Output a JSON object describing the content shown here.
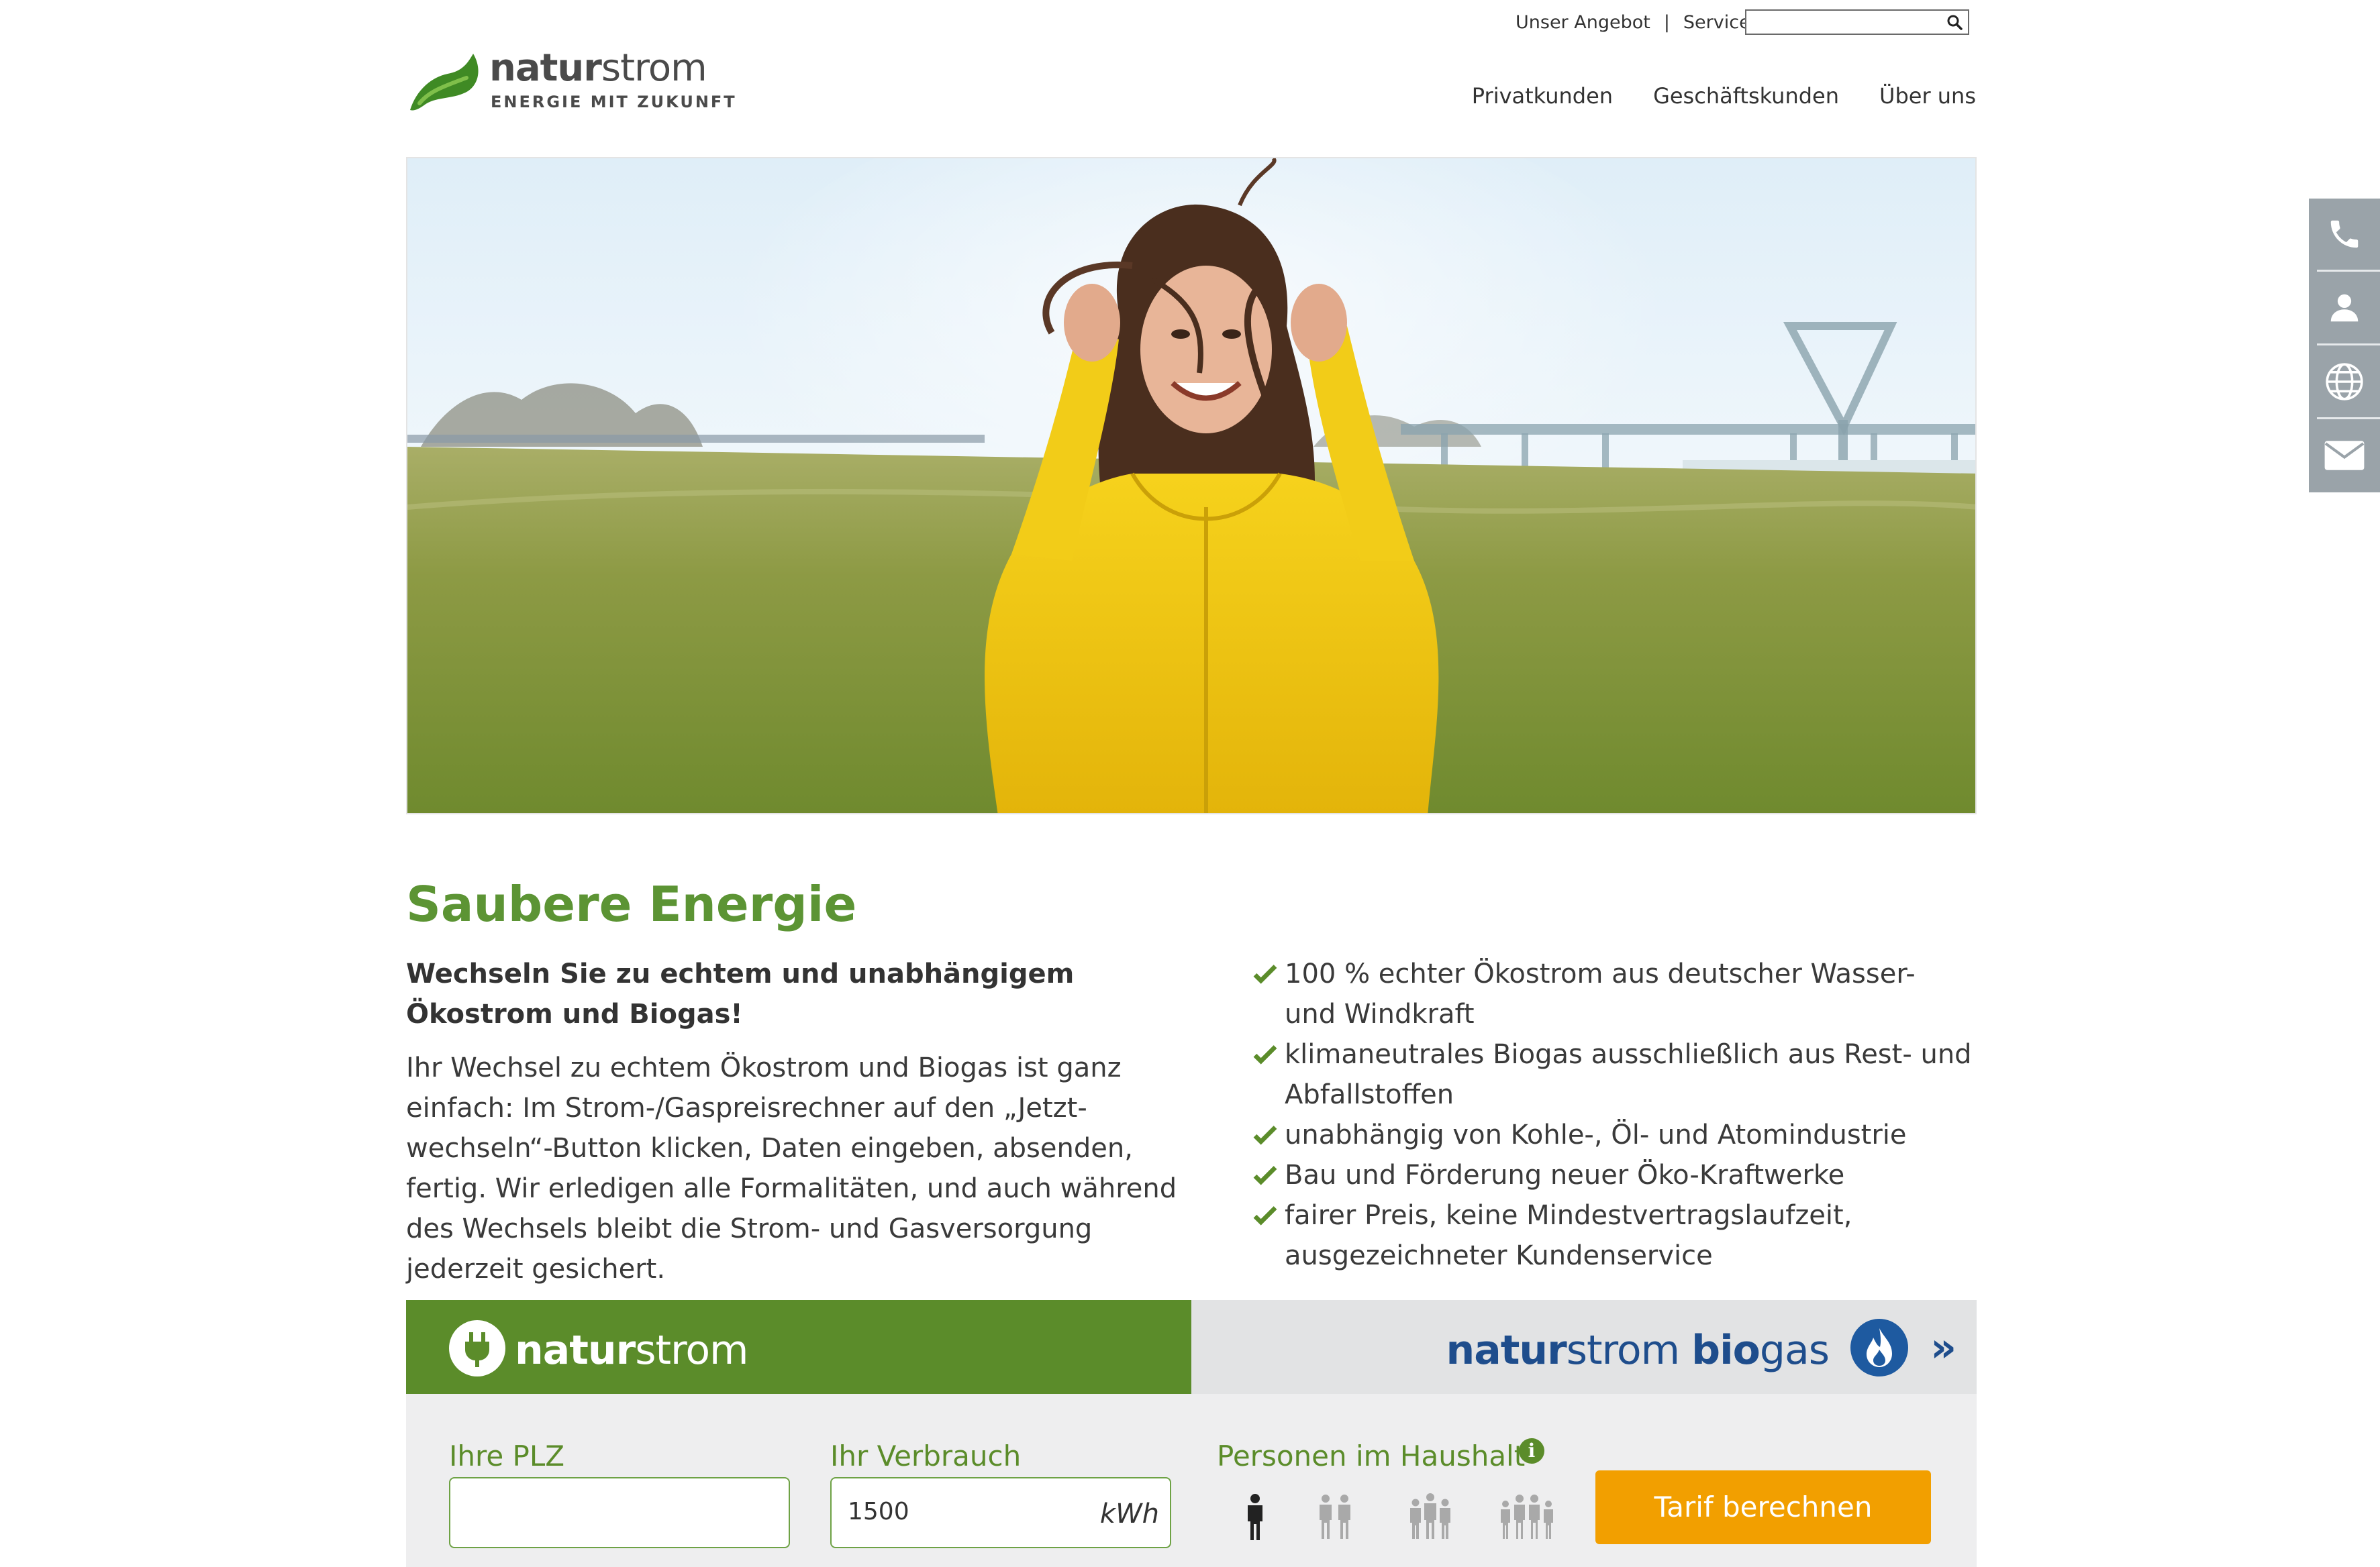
{
  "header": {
    "top_links": [
      "Unser Angebot",
      "Service"
    ],
    "separator": "|",
    "search": {
      "value": "",
      "placeholder": "",
      "icon": "search-icon"
    },
    "logo": {
      "word_bold": "natur",
      "word_light": "strom",
      "tagline": "ENERGIE MIT ZUKUNFT"
    },
    "nav": [
      "Privatkunden",
      "Geschäftskunden",
      "Über uns"
    ]
  },
  "side_widget": {
    "icons": [
      "phone-icon",
      "user-icon",
      "globe-icon",
      "mail-icon"
    ]
  },
  "hero": {
    "image": "woman-in-yellow-jacket-in-meadow-by-river-bridge"
  },
  "content": {
    "title": "Saubere Energie",
    "lead": "Wechseln Sie zu echtem und unabhängigem Ökostrom und Biogas!",
    "body": "Ihr Wechsel zu echtem Ökostrom und Biogas ist ganz einfach: Im Strom-/Gaspreisrechner auf den „Jetzt-wechseln“-Button klicken, Daten eingeben, absenden, fertig. Wir erledigen alle Formalitäten, und auch während des Wechsels bleibt die Strom- und Gasversorgung jederzeit gesichert.",
    "checklist": [
      "100 % echter Ökostrom aus deutscher Wasser- und Windkraft",
      "klimaneutrales Biogas ausschließlich aus Rest- und Abfallstoffen",
      "unabhängig von Kohle-, Öl- und Atomindustrie",
      "Bau und Förderung neuer Öko-Kraftwerke",
      "fairer Preis, keine Mindestvertragslaufzeit, ausgezeichneter Kundenservice"
    ]
  },
  "calculator": {
    "tabs": {
      "strom": {
        "bold": "natur",
        "light": "strom",
        "icon": "plug-icon",
        "active": true
      },
      "biogas": {
        "bold1": "natur",
        "light1": "strom ",
        "bold2": "bio",
        "light2": "gas",
        "icon": "flame-icon",
        "arrow": "»"
      }
    },
    "plz": {
      "label": "Ihre PLZ",
      "value": "",
      "placeholder": ""
    },
    "verbrauch": {
      "label": "Ihr Verbrauch",
      "value": "1500",
      "unit": "kWh"
    },
    "haushalt": {
      "label": "Personen im Haushalt",
      "info": "i",
      "selected_persons": 1,
      "options": [
        1,
        2,
        3,
        4
      ]
    },
    "submit_label": "Tarif berechnen"
  },
  "colors": {
    "brand_green": "#5b8c2a",
    "title_green": "#5c9434",
    "biogas_blue": "#1e4d8c",
    "cta_orange": "#f29f00",
    "side_grey": "#9aa3a9"
  }
}
